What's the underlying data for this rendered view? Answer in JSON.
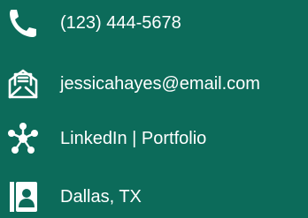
{
  "contact": {
    "phone": {
      "icon": "phone-icon",
      "text": "(123) 444-5678"
    },
    "email": {
      "icon": "envelope-icon",
      "text": "jessicahayes@email.com"
    },
    "links": {
      "icon": "network-icon",
      "text": "LinkedIn | Portfolio"
    },
    "location": {
      "icon": "contact-card-icon",
      "text": "Dallas, TX"
    }
  },
  "colors": {
    "background": "#0c6b5a",
    "foreground": "#ffffff"
  }
}
